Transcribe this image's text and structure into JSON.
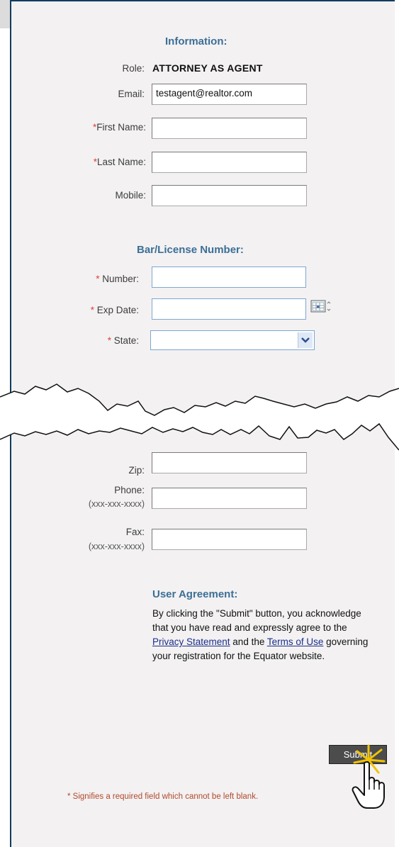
{
  "info": {
    "heading": "Information:",
    "role_label": "Role:",
    "role_value": "ATTORNEY AS AGENT",
    "email_label": "Email:",
    "email_value": "testagent@realtor.com",
    "first_name_label": "First Name:",
    "last_name_label": "Last Name:",
    "mobile_label": "Mobile:"
  },
  "license": {
    "heading": "Bar/License Number:",
    "number_label": "Number:",
    "exp_date_label": "Exp Date:",
    "state_label": "State:"
  },
  "contact": {
    "zip_label": "Zip:",
    "phone_label": "Phone:",
    "phone_format": "(xxx-xxx-xxxx)",
    "fax_label": "Fax:",
    "fax_format": "(xxx-xxx-xxxx)"
  },
  "agreement": {
    "heading": "User Agreement:",
    "text_1": "By clicking the \"Submit\" button, you acknowledge that you have read and expressly agree to the ",
    "privacy_link": "Privacy Statement",
    "text_2": " and the ",
    "terms_link": "Terms of Use",
    "text_3": " governing your registration for the Equator website."
  },
  "submit_label": "Submit",
  "required_marker": "*",
  "footnote": "* Signifies a required field which cannot be left blank."
}
